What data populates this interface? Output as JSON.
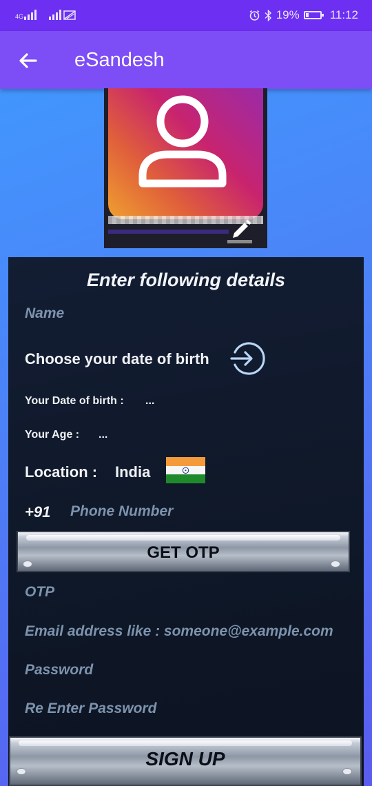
{
  "status_bar": {
    "network_type": "4G",
    "battery_percent": "19%",
    "time": "11:12",
    "icons": [
      "signal-icon",
      "signal-icon",
      "no-sim-icon",
      "alarm-icon",
      "bluetooth-icon",
      "battery-icon"
    ]
  },
  "app_bar": {
    "title": "eSandesh",
    "back_icon": "arrow-left-icon"
  },
  "avatar": {
    "icon": "user-icon",
    "edit_icon": "pencil-icon"
  },
  "form": {
    "title": "Enter following details",
    "name_placeholder": "Name",
    "dob_prompt": "Choose your date of birth",
    "dob_icon": "arrow-circle-right-icon",
    "dob_label": "Your Date of birth :",
    "dob_value": "...",
    "age_label": "Your Age :",
    "age_value": "...",
    "location_label": "Location :",
    "location_value": "India",
    "flag_icon": "india-flag-icon",
    "phone_prefix": "+91",
    "phone_placeholder": "Phone Number",
    "otp_button": "GET OTP",
    "otp_placeholder": "OTP",
    "email_placeholder": "Email address like : someone@example.com",
    "password_placeholder": "Password",
    "reenter_password_placeholder": "Re Enter Password",
    "signup_button": "SIGN UP"
  },
  "colors": {
    "status_bar": "#6d2ff1",
    "app_bar": "#7d4df6",
    "card": "#111a2c",
    "placeholder": "#7d93ad"
  }
}
